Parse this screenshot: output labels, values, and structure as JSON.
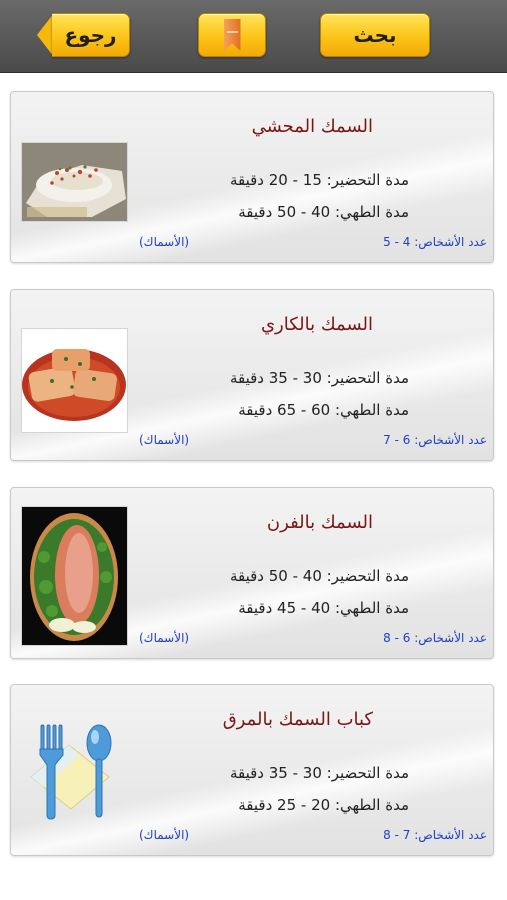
{
  "toolbar": {
    "back_label": "رجوع",
    "search_label": "بحث"
  },
  "recipes": [
    {
      "title": "السمك المحشي",
      "prep": "مدة التحضير: 15 - 20 دقيقة",
      "cook": "مدة الطهي: 40 - 50 دقيقة",
      "persons": "عدد الأشخاص: 4 - 5",
      "category": "(الأسماك)"
    },
    {
      "title": "السمك بالكاري",
      "prep": "مدة التحضير: 30 - 35 دقيقة",
      "cook": "مدة الطهي: 60 - 65 دقيقة",
      "persons": "عدد الأشخاص: 6 - 7",
      "category": "(الأسماك)"
    },
    {
      "title": "السمك بالفرن",
      "prep": "مدة التحضير: 40 - 50 دقيقة",
      "cook": "مدة الطهي: 40 - 45 دقيقة",
      "persons": "عدد الأشخاص: 6 - 8",
      "category": "(الأسماك)"
    },
    {
      "title": "كباب السمك بالمرق",
      "prep": "مدة التحضير: 30 - 35 دقيقة",
      "cook": "مدة الطهي: 20 - 25 دقيقة",
      "persons": "عدد الأشخاص: 7 - 8",
      "category": "(الأسماك)"
    }
  ]
}
